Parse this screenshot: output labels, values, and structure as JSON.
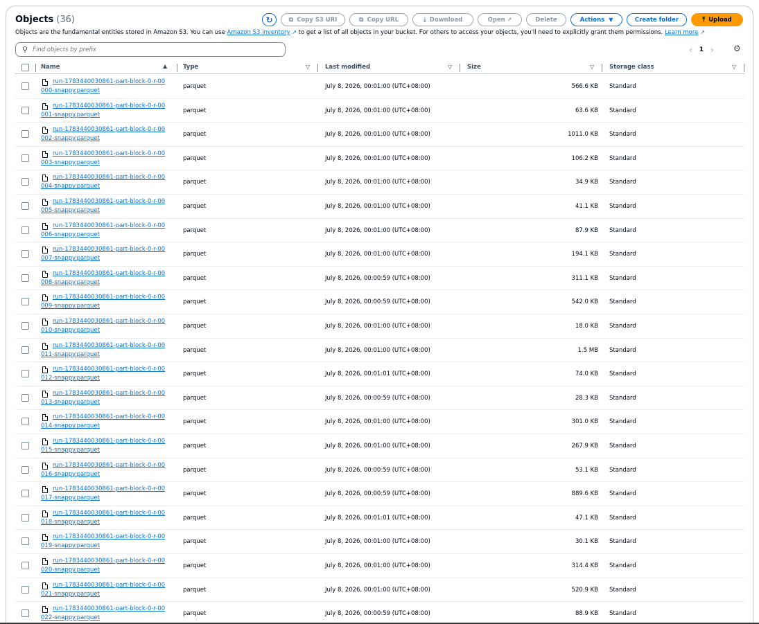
{
  "header": {
    "title": "Objects",
    "count": "(36)",
    "description_pre": "Objects are the fundamental entities stored in Amazon S3. You can use ",
    "inventory_link": "Amazon S3 inventory",
    "description_mid": " to get a list of all objects in your bucket. For others to access your objects, you'll need to explicitly grant them permissions. ",
    "learn_more": "Learn more"
  },
  "toolbar": {
    "copy_s3_uri": "Copy S3 URI",
    "copy_url": "Copy URL",
    "download": "Download",
    "open": "Open",
    "delete": "Delete",
    "actions": "Actions",
    "create_folder": "Create folder",
    "upload": "Upload"
  },
  "search": {
    "placeholder": "Find objects by prefix"
  },
  "pagination": {
    "current_page": "1"
  },
  "columns": {
    "name": "Name",
    "type": "Type",
    "last_modified": "Last modified",
    "size": "Size",
    "storage_class": "Storage class"
  },
  "rows": [
    {
      "name": "run-1783440030861-part-block-0-r-00000-snappy.parquet",
      "type": "parquet",
      "modified": "July 8, 2026, 00:01:00 (UTC+08:00)",
      "size": "566.6 KB",
      "storage": "Standard"
    },
    {
      "name": "run-1783440030861-part-block-0-r-00001-snappy.parquet",
      "type": "parquet",
      "modified": "July 8, 2026, 00:01:00 (UTC+08:00)",
      "size": "63.6 KB",
      "storage": "Standard"
    },
    {
      "name": "run-1783440030861-part-block-0-r-00002-snappy.parquet",
      "type": "parquet",
      "modified": "July 8, 2026, 00:01:00 (UTC+08:00)",
      "size": "1011.0 KB",
      "storage": "Standard"
    },
    {
      "name": "run-1783440030861-part-block-0-r-00003-snappy.parquet",
      "type": "parquet",
      "modified": "July 8, 2026, 00:01:00 (UTC+08:00)",
      "size": "106.2 KB",
      "storage": "Standard"
    },
    {
      "name": "run-1783440030861-part-block-0-r-00004-snappy.parquet",
      "type": "parquet",
      "modified": "July 8, 2026, 00:01:00 (UTC+08:00)",
      "size": "34.9 KB",
      "storage": "Standard"
    },
    {
      "name": "run-1783440030861-part-block-0-r-00005-snappy.parquet",
      "type": "parquet",
      "modified": "July 8, 2026, 00:01:00 (UTC+08:00)",
      "size": "41.1 KB",
      "storage": "Standard"
    },
    {
      "name": "run-1783440030861-part-block-0-r-00006-snappy.parquet",
      "type": "parquet",
      "modified": "July 8, 2026, 00:01:00 (UTC+08:00)",
      "size": "87.9 KB",
      "storage": "Standard"
    },
    {
      "name": "run-1783440030861-part-block-0-r-00007-snappy.parquet",
      "type": "parquet",
      "modified": "July 8, 2026, 00:01:00 (UTC+08:00)",
      "size": "194.1 KB",
      "storage": "Standard"
    },
    {
      "name": "run-1783440030861-part-block-0-r-00008-snappy.parquet",
      "type": "parquet",
      "modified": "July 8, 2026, 00:00:59 (UTC+08:00)",
      "size": "311.1 KB",
      "storage": "Standard"
    },
    {
      "name": "run-1783440030861-part-block-0-r-00009-snappy.parquet",
      "type": "parquet",
      "modified": "July 8, 2026, 00:00:59 (UTC+08:00)",
      "size": "542.0 KB",
      "storage": "Standard"
    },
    {
      "name": "run-1783440030861-part-block-0-r-00010-snappy.parquet",
      "type": "parquet",
      "modified": "July 8, 2026, 00:01:00 (UTC+08:00)",
      "size": "18.0 KB",
      "storage": "Standard"
    },
    {
      "name": "run-1783440030861-part-block-0-r-00011-snappy.parquet",
      "type": "parquet",
      "modified": "July 8, 2026, 00:01:00 (UTC+08:00)",
      "size": "1.5 MB",
      "storage": "Standard"
    },
    {
      "name": "run-1783440030861-part-block-0-r-00012-snappy.parquet",
      "type": "parquet",
      "modified": "July 8, 2026, 00:01:01 (UTC+08:00)",
      "size": "74.0 KB",
      "storage": "Standard"
    },
    {
      "name": "run-1783440030861-part-block-0-r-00013-snappy.parquet",
      "type": "parquet",
      "modified": "July 8, 2026, 00:00:59 (UTC+08:00)",
      "size": "28.3 KB",
      "storage": "Standard"
    },
    {
      "name": "run-1783440030861-part-block-0-r-00014-snappy.parquet",
      "type": "parquet",
      "modified": "July 8, 2026, 00:01:00 (UTC+08:00)",
      "size": "301.0 KB",
      "storage": "Standard"
    },
    {
      "name": "run-1783440030861-part-block-0-r-00015-snappy.parquet",
      "type": "parquet",
      "modified": "July 8, 2026, 00:01:00 (UTC+08:00)",
      "size": "267.9 KB",
      "storage": "Standard"
    },
    {
      "name": "run-1783440030861-part-block-0-r-00016-snappy.parquet",
      "type": "parquet",
      "modified": "July 8, 2026, 00:00:59 (UTC+08:00)",
      "size": "53.1 KB",
      "storage": "Standard"
    },
    {
      "name": "run-1783440030861-part-block-0-r-00017-snappy.parquet",
      "type": "parquet",
      "modified": "July 8, 2026, 00:00:59 (UTC+08:00)",
      "size": "889.6 KB",
      "storage": "Standard"
    },
    {
      "name": "run-1783440030861-part-block-0-r-00018-snappy.parquet",
      "type": "parquet",
      "modified": "July 8, 2026, 00:01:01 (UTC+08:00)",
      "size": "47.1 KB",
      "storage": "Standard"
    },
    {
      "name": "run-1783440030861-part-block-0-r-00019-snappy.parquet",
      "type": "parquet",
      "modified": "July 8, 2026, 00:01:00 (UTC+08:00)",
      "size": "30.1 KB",
      "storage": "Standard"
    },
    {
      "name": "run-1783440030861-part-block-0-r-00020-snappy.parquet",
      "type": "parquet",
      "modified": "July 8, 2026, 00:01:00 (UTC+08:00)",
      "size": "314.4 KB",
      "storage": "Standard"
    },
    {
      "name": "run-1783440030861-part-block-0-r-00021-snappy.parquet",
      "type": "parquet",
      "modified": "July 8, 2026, 00:01:00 (UTC+08:00)",
      "size": "520.9 KB",
      "storage": "Standard"
    },
    {
      "name": "run-1783440030861-part-block-0-r-00022-snappy.parquet",
      "type": "parquet",
      "modified": "July 8, 2026, 00:00:59 (UTC+08:00)",
      "size": "88.9 KB",
      "storage": "Standard"
    }
  ]
}
